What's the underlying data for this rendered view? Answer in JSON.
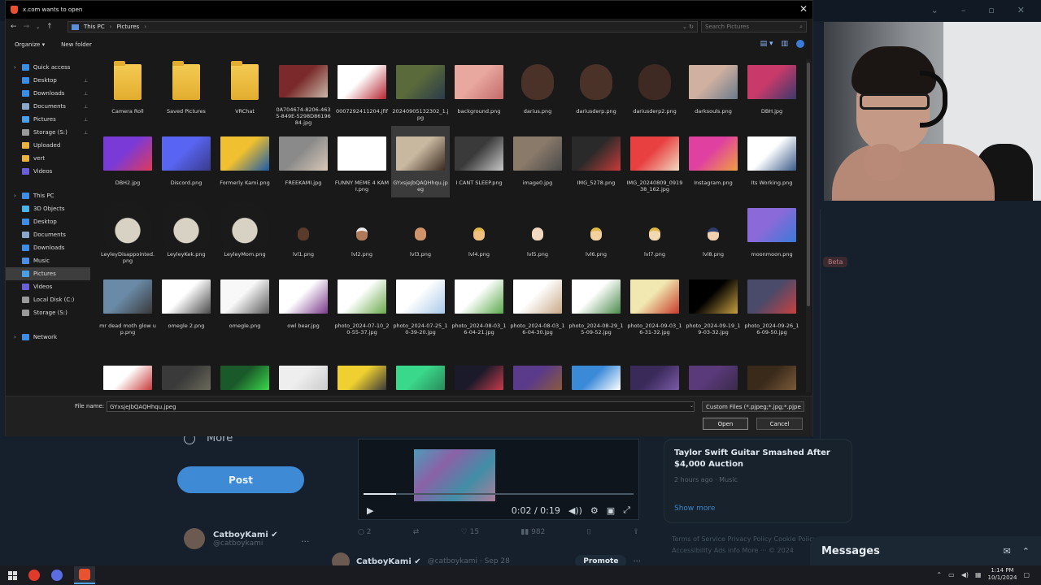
{
  "dialog": {
    "title": "x.com wants to open",
    "breadcrumb": [
      "This PC",
      "Pictures"
    ],
    "search_placeholder": "Search Pictures",
    "organize_label": "Organize ▾",
    "new_folder_label": "New folder",
    "file_name_label": "File name:",
    "file_name_value": "GYxsjeJbQAQHhqu.jpeg",
    "file_type_value": "Custom Files (*.pjpeg;*.jpg;*.pjpe",
    "open_label": "Open",
    "cancel_label": "Cancel"
  },
  "nav": {
    "items": [
      {
        "label": "Quick access",
        "icon": "star-icon",
        "color": "#3b8fe0",
        "type": "head"
      },
      {
        "label": "Desktop",
        "icon": "desktop-icon",
        "color": "#3a8ee6",
        "pin": true
      },
      {
        "label": "Downloads",
        "icon": "download-icon",
        "color": "#3a8ee6",
        "pin": true
      },
      {
        "label": "Documents",
        "icon": "document-icon",
        "color": "#8aa6c8",
        "pin": true
      },
      {
        "label": "Pictures",
        "icon": "picture-icon",
        "color": "#4aa0e8",
        "pin": true
      },
      {
        "label": "Storage (S:)",
        "icon": "drive-icon",
        "color": "#9a9a9a",
        "pin": true
      },
      {
        "label": "Uploaded",
        "icon": "folder-icon",
        "color": "#e8b53a"
      },
      {
        "label": "vert",
        "icon": "folder-icon",
        "color": "#e8b53a"
      },
      {
        "label": "Videos",
        "icon": "video-icon",
        "color": "#6b5fd6"
      },
      {
        "label": "",
        "type": "gap"
      },
      {
        "label": "This PC",
        "icon": "computer-icon",
        "color": "#3a8ee6",
        "type": "head"
      },
      {
        "label": "3D Objects",
        "icon": "cube-icon",
        "color": "#4ab3e8"
      },
      {
        "label": "Desktop",
        "icon": "desktop-icon",
        "color": "#3a8ee6"
      },
      {
        "label": "Documents",
        "icon": "document-icon",
        "color": "#8aa6c8"
      },
      {
        "label": "Downloads",
        "icon": "download-icon",
        "color": "#3a8ee6"
      },
      {
        "label": "Music",
        "icon": "music-icon",
        "color": "#4a8ee6"
      },
      {
        "label": "Pictures",
        "icon": "picture-icon",
        "color": "#4aa0e8",
        "selected": true
      },
      {
        "label": "Videos",
        "icon": "video-icon",
        "color": "#6b5fd6"
      },
      {
        "label": "Local Disk (C:)",
        "icon": "drive-icon",
        "color": "#9a9a9a"
      },
      {
        "label": "Storage (S:)",
        "icon": "drive-icon",
        "color": "#9a9a9a"
      },
      {
        "label": "",
        "type": "gap"
      },
      {
        "label": "Network",
        "icon": "network-icon",
        "color": "#3a8ee6",
        "type": "head"
      }
    ]
  },
  "files": [
    {
      "name": "Camera Roll",
      "kind": "folder"
    },
    {
      "name": "Saved Pictures",
      "kind": "folder"
    },
    {
      "name": "VRChat",
      "kind": "folder"
    },
    {
      "name": "0A704674-8206-4635-849E-5298D8619684.jpg",
      "kind": "img",
      "c1": "#7a2a2a",
      "c2": "#c9b8a8"
    },
    {
      "name": "0007292411204.jfif",
      "kind": "img",
      "c1": "#ffffff",
      "c2": "#b52330"
    },
    {
      "name": "20240905132302_1.jpg",
      "kind": "img",
      "c1": "#5a6a3a",
      "c2": "#2a3a4a"
    },
    {
      "name": "background.png",
      "kind": "img",
      "c1": "#e8a8a0",
      "c2": "#c26a6a"
    },
    {
      "name": "darius.png",
      "kind": "face",
      "c1": "#4a3228"
    },
    {
      "name": "dariusderp.png",
      "kind": "face",
      "c1": "#4a3228"
    },
    {
      "name": "dariusderp2.png",
      "kind": "face",
      "c1": "#3e2a22"
    },
    {
      "name": "darksouls.png",
      "kind": "img",
      "c1": "#d0b0a0",
      "c2": "#6a7a8a"
    },
    {
      "name": "DBH.jpg",
      "kind": "img",
      "c1": "#c83a6a",
      "c2": "#3a3a6a"
    },
    {
      "name": "DBH2.jpg",
      "kind": "img",
      "c1": "#7a3ad8",
      "c2": "#e03a5a"
    },
    {
      "name": "Discord.png",
      "kind": "img",
      "c1": "#5865f2",
      "c2": "#3a3a8a"
    },
    {
      "name": "Formerly Kami.png",
      "kind": "img",
      "c1": "#f0c030",
      "c2": "#1a5aa8"
    },
    {
      "name": "FREEKAMI.jpg",
      "kind": "img",
      "c1": "#8a8a8a",
      "c2": "#d8c8b8"
    },
    {
      "name": "FUNNY MEME 4 KAMI.png",
      "kind": "img",
      "c1": "#ffffff",
      "c2": "#ffffff"
    },
    {
      "name": "GYxsjeJbQAQHhqu.jpeg",
      "kind": "img",
      "c1": "#c8b8a0",
      "c2": "#3a2a20",
      "selected": true
    },
    {
      "name": "I CANT SLEEP.png",
      "kind": "img",
      "c1": "#3a3a3a",
      "c2": "#c8c8c8"
    },
    {
      "name": "image0.jpg",
      "kind": "img",
      "c1": "#8a7a6a",
      "c2": "#4a4a4a"
    },
    {
      "name": "IMG_5278.png",
      "kind": "img",
      "c1": "#2a2a2a",
      "c2": "#c83a3a"
    },
    {
      "name": "IMG_20240809_091938_162.jpg",
      "kind": "img",
      "c1": "#e84040",
      "c2": "#f0d8c0"
    },
    {
      "name": "Instagram.png",
      "kind": "img",
      "c1": "#e040a0",
      "c2": "#f0a040"
    },
    {
      "name": "Its Working.png",
      "kind": "img",
      "c1": "#ffffff",
      "c2": "#3a5a8a"
    },
    {
      "name": "LeyleyDisappointed.png",
      "kind": "anime"
    },
    {
      "name": "LeyleyKek.png",
      "kind": "anime"
    },
    {
      "name": "LeyleyMom.png",
      "kind": "anime"
    },
    {
      "name": "lvl1.png",
      "kind": "emoji",
      "c1": "#5a3a2a",
      "hair": ""
    },
    {
      "name": "lvl2.png",
      "kind": "emoji",
      "c1": "#b07a5a",
      "hair": "white"
    },
    {
      "name": "lvl3.png",
      "kind": "emoji",
      "c1": "#d0946a",
      "hair": ""
    },
    {
      "name": "lvl4.png",
      "kind": "emoji",
      "c1": "#f0c080",
      "hair": "blond"
    },
    {
      "name": "lvl5.png",
      "kind": "emoji",
      "c1": "#f2d8c0",
      "hair": ""
    },
    {
      "name": "lvl6.png",
      "kind": "emoji",
      "c1": "#f2d0a0",
      "hair": "blond"
    },
    {
      "name": "lvl7.png",
      "kind": "emoji",
      "c1": "#f2d8b0",
      "hair": "blond"
    },
    {
      "name": "lvl8.png",
      "kind": "emoji",
      "c1": "#f0d0b0",
      "hair": "hat"
    },
    {
      "name": "moonmoon.png",
      "kind": "img",
      "c1": "#8a6ad8",
      "c2": "#3a7ad8"
    },
    {
      "name": "mr dead moth glow up.png",
      "kind": "img",
      "c1": "#6a8aa8",
      "c2": "#3a3a3a"
    },
    {
      "name": "omegle 2.png",
      "kind": "img",
      "c1": "#ffffff",
      "c2": "#4a4a4a"
    },
    {
      "name": "omegle.png",
      "kind": "img",
      "c1": "#f8f8f8",
      "c2": "#5a5a5a"
    },
    {
      "name": "owl bear.jpg",
      "kind": "img",
      "c1": "#ffffff",
      "c2": "#7a3a8a"
    },
    {
      "name": "photo_2024-07-10_20-55-37.jpg",
      "kind": "img",
      "c1": "#ffffff",
      "c2": "#6aa84a"
    },
    {
      "name": "photo_2024-07-25_10-39-20.jpg",
      "kind": "img",
      "c1": "#ffffff",
      "c2": "#aac8e8"
    },
    {
      "name": "photo_2024-08-03_16-04-21.jpg",
      "kind": "img",
      "c1": "#ffffff",
      "c2": "#5aa84a"
    },
    {
      "name": "photo_2024-08-03_16-04-30.jpg",
      "kind": "img",
      "c1": "#ffffff",
      "c2": "#c8a888"
    },
    {
      "name": "photo_2024-08-29_15-09-52.jpg",
      "kind": "img",
      "c1": "#ffffff",
      "c2": "#4a8a4a"
    },
    {
      "name": "photo_2024-09-03_16-31-32.jpg",
      "kind": "img",
      "c1": "#f0e8b0",
      "c2": "#c83a2a"
    },
    {
      "name": "photo_2024-09-19_19-03-32.jpg",
      "kind": "img",
      "c1": "#000000",
      "c2": "#c8a040"
    },
    {
      "name": "photo_2024-09-26_16-09-50.jpg",
      "kind": "img",
      "c1": "#4a4a6a",
      "c2": "#c84040"
    },
    {
      "name": "",
      "kind": "partial",
      "c1": "#ffffff",
      "c2": "#c83a3a"
    },
    {
      "name": "",
      "kind": "partial",
      "c1": "#3a3a3a",
      "c2": "#6a6a5a"
    },
    {
      "name": "",
      "kind": "partial",
      "c1": "#1a5a2a",
      "c2": "#3ad84a"
    },
    {
      "name": "",
      "kind": "partial",
      "c1": "#eeeeee",
      "c2": "#cccccc"
    },
    {
      "name": "",
      "kind": "partial",
      "c1": "#f0d030",
      "c2": "#3a3a3a"
    },
    {
      "name": "",
      "kind": "partial",
      "c1": "#3ad88a",
      "c2": "#2a8a5a"
    },
    {
      "name": "",
      "kind": "partial",
      "c1": "#1a1a2a",
      "c2": "#c83a4a"
    },
    {
      "name": "",
      "kind": "partial",
      "c1": "#5a3a8a",
      "c2": "#8a5a3a"
    },
    {
      "name": "",
      "kind": "partial",
      "c1": "#3a8ad8",
      "c2": "#ffffff"
    },
    {
      "name": "",
      "kind": "partial",
      "c1": "#3a2a5a",
      "c2": "#7a5aa8"
    },
    {
      "name": "",
      "kind": "partial",
      "c1": "#5a3a7a",
      "c2": "#3a2a4a"
    },
    {
      "name": "",
      "kind": "partial",
      "c1": "#3a2a1a",
      "c2": "#7a5a3a"
    }
  ],
  "background": {
    "more_label": "More",
    "post_label": "Post",
    "profile_name": "CatboyKami ✔",
    "profile_handle": "@catboykami",
    "video_time": "0:02 / 0:19",
    "tweet_name": "CatboyKami ✔",
    "tweet_handle": "@catboykami · Sep 28",
    "promote_label": "Promote",
    "trend_title": "Taylor Swift Guitar Smashed After $4,000 Auction",
    "trend_meta": "2 hours ago · Music",
    "show_more": "Show more",
    "footer_links": "Terms of Service   Privacy Policy   Cookie Policy   Accessibility   Ads info   More ···   © 2024",
    "messages_label": "Messages",
    "beta_label": "Beta",
    "action_counts": [
      "2",
      "",
      "15",
      "982"
    ]
  },
  "taskbar": {
    "time": "1:14 PM",
    "date": "10/1/2024"
  }
}
